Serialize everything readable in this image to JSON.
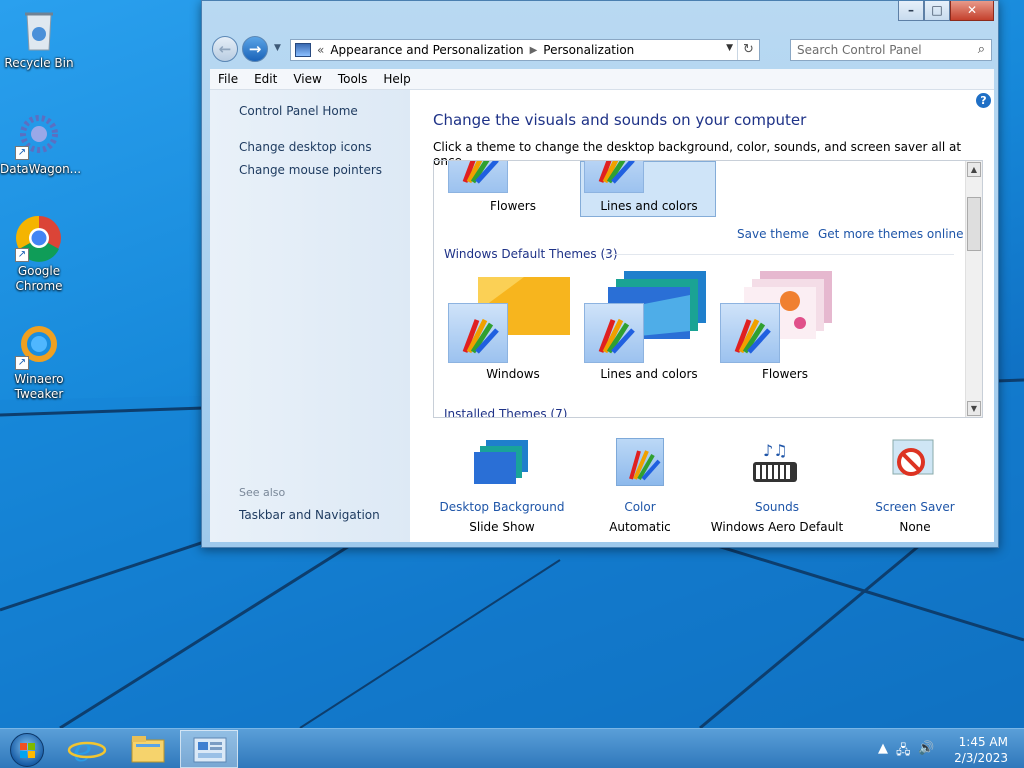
{
  "desktop": {
    "icons": [
      {
        "label": "Recycle Bin",
        "icon": "recycle-bin-icon"
      },
      {
        "label": "DataWagon...",
        "icon": "datawagon-icon"
      },
      {
        "label": "Google Chrome",
        "icon": "chrome-icon"
      },
      {
        "label": "Winaero Tweaker",
        "icon": "winaero-tweaker-icon"
      }
    ]
  },
  "window": {
    "caption_buttons": {
      "minimize": "–",
      "maximize": "□",
      "close": "✕"
    },
    "breadcrumb": {
      "prefix": "«",
      "items": [
        "Appearance and Personalization",
        "Personalization"
      ]
    },
    "search": {
      "placeholder": "Search Control Panel"
    },
    "menu": [
      "File",
      "Edit",
      "View",
      "Tools",
      "Help"
    ],
    "left_pane": {
      "links": [
        "Control Panel Home",
        "Change desktop icons",
        "Change mouse pointers"
      ],
      "see_also": "See also",
      "see_also_links": [
        "Taskbar and Navigation"
      ]
    },
    "content": {
      "title": "Change the visuals and sounds on your computer",
      "subtitle": "Click a theme to change the desktop background, color, sounds, and screen saver all at once.",
      "my_themes": [
        {
          "name": "Flowers",
          "selected": false
        },
        {
          "name": "Lines and colors",
          "selected": true
        }
      ],
      "save_theme": "Save theme",
      "get_more": "Get more themes online",
      "default_section": "Windows Default Themes (3)",
      "default_themes": [
        "Windows",
        "Lines and colors",
        "Flowers"
      ],
      "installed_section": "Installed Themes (7)",
      "settings": [
        {
          "label": "Desktop Background",
          "value": "Slide Show",
          "icon": "desktop-background-icon"
        },
        {
          "label": "Color",
          "value": "Automatic",
          "icon": "color-icon"
        },
        {
          "label": "Sounds",
          "value": "Windows Aero Default",
          "icon": "sounds-icon"
        },
        {
          "label": "Screen Saver",
          "value": "None",
          "icon": "screen-saver-icon"
        }
      ]
    }
  },
  "taskbar": {
    "time": "1:45 AM",
    "date": "2/3/2023",
    "pinned": [
      "start-button",
      "internet-explorer",
      "file-explorer",
      "control-panel"
    ]
  }
}
